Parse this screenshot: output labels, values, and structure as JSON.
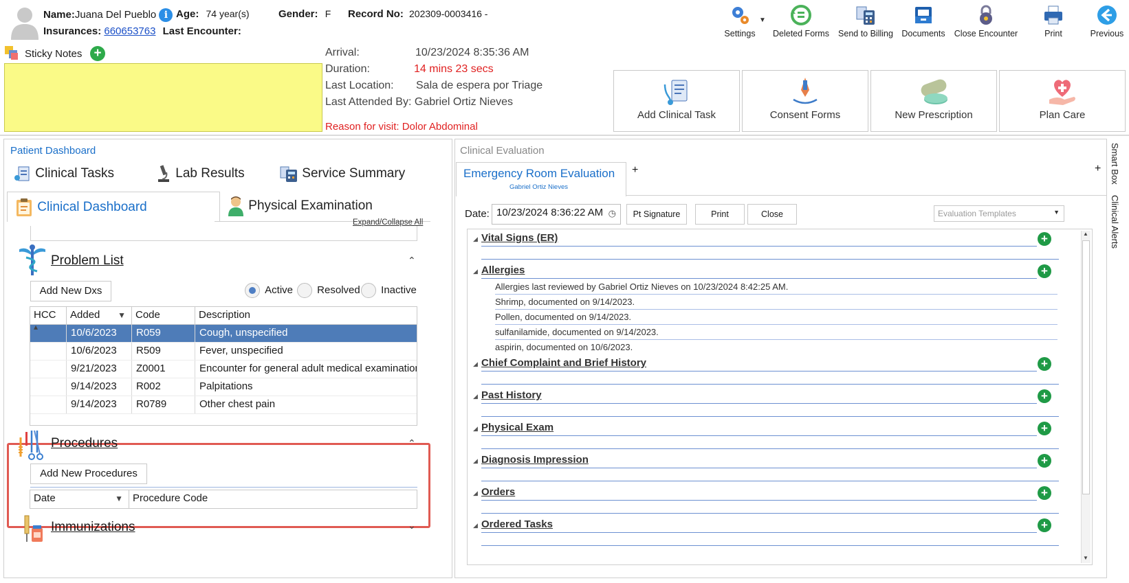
{
  "header": {
    "name_label": "Name:",
    "name_value": "Juana Del Pueblo",
    "age_label": "Age:",
    "age_value": "74 year(s)",
    "gender_label": "Gender:",
    "gender_value": "F",
    "record_label": "Record No:",
    "record_value": "202309-0003416 -",
    "insurances_label": "Insurances:",
    "insurances_value": "660653763",
    "last_encounter_label": "Last Encounter:"
  },
  "toolbar": {
    "settings": "Settings",
    "deleted_forms": "Deleted Forms",
    "send_to_billing": "Send to Billing",
    "documents": "Documents",
    "close_encounter": "Close Encounter",
    "print": "Print",
    "previous": "Previous"
  },
  "sticky": {
    "label": "Sticky Notes",
    "add": "+"
  },
  "encounter": {
    "arrival_label": "Arrival:",
    "arrival_value": "10/23/2024 8:35:36 AM",
    "duration_label": "Duration:",
    "duration_value": "14 mins 23 secs",
    "location_label": "Last Location:",
    "location_value": "Sala de espera por Triage",
    "attended": "Last Attended By: Gabriel Ortiz Nieves",
    "reason": "Reason for visit: Dolor Abdominal"
  },
  "actions": {
    "add_clinical_task": "Add Clinical Task",
    "consent_forms": "Consent Forms",
    "new_prescription": "New Prescription",
    "plan_care": "Plan Care"
  },
  "left": {
    "title": "Patient Dashboard",
    "tabs": {
      "clinical_tasks": "Clinical Tasks",
      "lab_results": "Lab Results",
      "service_summary": "Service Summary",
      "clinical_dashboard": "Clinical Dashboard",
      "physical_examination": "Physical Examination"
    },
    "expand_collapse": "Expand/Collapse All",
    "problem_list": {
      "title": "Problem List",
      "add_button": "Add New Dxs",
      "filters": [
        "Active",
        "Resolved",
        "Inactive"
      ],
      "columns": [
        "HCC",
        "Added",
        "Code",
        "Description"
      ],
      "rows": [
        {
          "hcc": "",
          "added": "10/6/2023",
          "code": "R059",
          "desc": "Cough, unspecified"
        },
        {
          "hcc": "",
          "added": "10/6/2023",
          "code": "R509",
          "desc": "Fever, unspecified"
        },
        {
          "hcc": "",
          "added": "9/21/2023",
          "code": "Z0001",
          "desc": "Encounter for general adult medical examination"
        },
        {
          "hcc": "",
          "added": "9/14/2023",
          "code": "R002",
          "desc": "Palpitations"
        },
        {
          "hcc": "",
          "added": "9/14/2023",
          "code": "R0789",
          "desc": "Other chest pain"
        }
      ]
    },
    "procedures": {
      "title": "Procedures",
      "add_button": "Add New Procedures",
      "columns": [
        "Date",
        "Procedure Code"
      ]
    },
    "immunizations": {
      "title": "Immunizations"
    }
  },
  "right": {
    "title": "Clinical Evaluation",
    "tab_title": "Emergency Room Evaluation",
    "tab_subtitle": "Gabriel Ortiz Nieves",
    "add_tab": "+",
    "date_label": "Date:",
    "date_value": "10/23/2024 8:36:22 AM",
    "pt_signature": "Pt Signature",
    "print": "Print",
    "close": "Close",
    "templates_placeholder": "Evaluation Templates",
    "sections": {
      "vital_signs": "Vital Signs (ER)",
      "allergies": "Allergies",
      "chief_complaint": "Chief Complaint and Brief History",
      "past_history": "Past History",
      "physical_exam": "Physical Exam",
      "diagnosis": "Diagnosis Impression",
      "orders": "Orders",
      "ordered_tasks": "Ordered Tasks"
    },
    "allergy_items": [
      "Allergies last reviewed by Gabriel Ortiz Nieves on 10/23/2024 8:42:25 AM.",
      "Shrimp, documented on 9/14/2023.",
      "Pollen, documented on 9/14/2023.",
      "sulfanilamide, documented on 9/14/2023.",
      "aspirin, documented on 10/6/2023."
    ]
  },
  "side_tabs": {
    "smart_box": "Smart Box",
    "clinical_alerts": "Clinical Alerts"
  },
  "colors": {
    "accent": "#1a6fc9",
    "alert": "#e02020",
    "selected_row": "#4e7cb8",
    "sticky": "#fafa87",
    "add_green": "#1f9a46"
  }
}
